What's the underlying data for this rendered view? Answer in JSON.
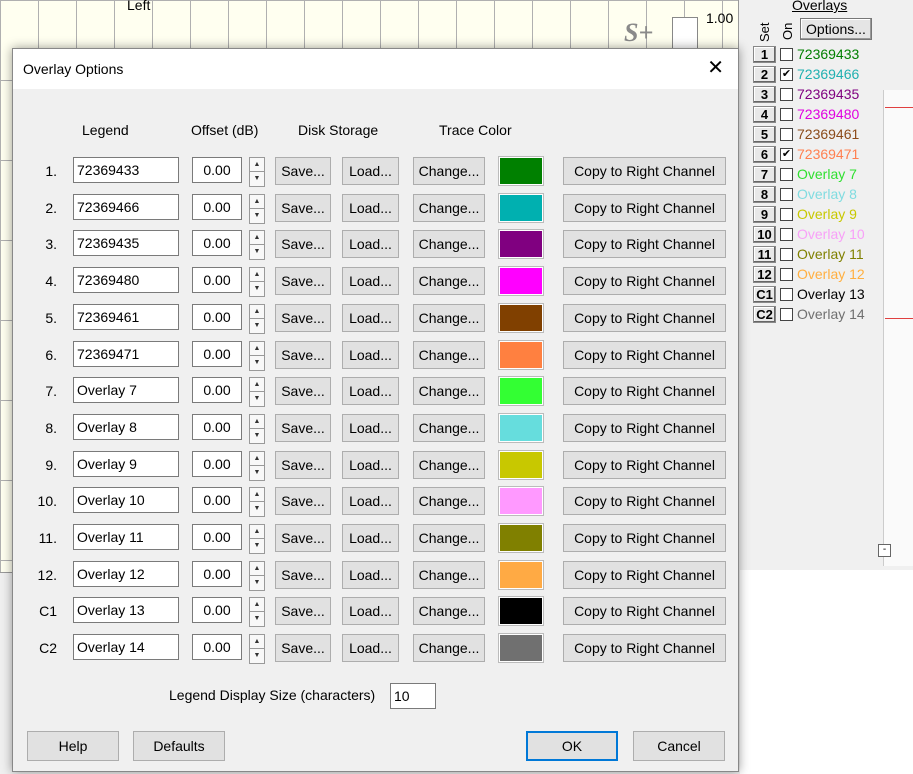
{
  "background": {
    "top_label": "Left",
    "logo_text": "S+",
    "scale_value": "1.00",
    "overlays_panel": {
      "title": "Overlays",
      "set_header": "Set",
      "on_header": "On",
      "options_label": "Options...",
      "minimize_glyph": "-",
      "items": [
        {
          "set": "1",
          "checked": false,
          "name": "72369433",
          "color": "#008000"
        },
        {
          "set": "2",
          "checked": true,
          "name": "72369466",
          "color": "#20b0b0"
        },
        {
          "set": "3",
          "checked": false,
          "name": "72369435",
          "color": "#800080"
        },
        {
          "set": "4",
          "checked": false,
          "name": "72369480",
          "color": "#e000e0"
        },
        {
          "set": "5",
          "checked": false,
          "name": "72369461",
          "color": "#8b4a1a"
        },
        {
          "set": "6",
          "checked": true,
          "name": "72369471",
          "color": "#ff7f50"
        },
        {
          "set": "7",
          "checked": false,
          "name": "Overlay 7",
          "color": "#30e030"
        },
        {
          "set": "8",
          "checked": false,
          "name": "Overlay 8",
          "color": "#80dce0"
        },
        {
          "set": "9",
          "checked": false,
          "name": "Overlay 9",
          "color": "#c8c800"
        },
        {
          "set": "10",
          "checked": false,
          "name": "Overlay 10",
          "color": "#f8a0f8"
        },
        {
          "set": "11",
          "checked": false,
          "name": "Overlay 11",
          "color": "#808000"
        },
        {
          "set": "12",
          "checked": false,
          "name": "Overlay 12",
          "color": "#ffb040"
        },
        {
          "set": "C1",
          "checked": false,
          "name": "Overlay 13",
          "color": "#000000"
        },
        {
          "set": "C2",
          "checked": false,
          "name": "Overlay 14",
          "color": "#707070"
        }
      ]
    }
  },
  "dialog": {
    "title": "Overlay Options",
    "close_glyph": "✕",
    "headers": {
      "legend": "Legend",
      "offset": "Offset (dB)",
      "disk_storage": "Disk Storage",
      "trace_color": "Trace Color"
    },
    "buttons": {
      "save": "Save...",
      "load": "Load...",
      "change": "Change...",
      "copy": "Copy to Right Channel"
    },
    "rows": [
      {
        "label": "1.",
        "legend": "72369433",
        "offset": "0.00",
        "color": "#008000"
      },
      {
        "label": "2.",
        "legend": "72369466",
        "offset": "0.00",
        "color": "#00b0b0"
      },
      {
        "label": "3.",
        "legend": "72369435",
        "offset": "0.00",
        "color": "#800080"
      },
      {
        "label": "4.",
        "legend": "72369480",
        "offset": "0.00",
        "color": "#ff00ff"
      },
      {
        "label": "5.",
        "legend": "72369461",
        "offset": "0.00",
        "color": "#804000"
      },
      {
        "label": "6.",
        "legend": "72369471",
        "offset": "0.00",
        "color": "#ff8040"
      },
      {
        "label": "7.",
        "legend": "Overlay 7",
        "offset": "0.00",
        "color": "#33ff33"
      },
      {
        "label": "8.",
        "legend": "Overlay 8",
        "offset": "0.00",
        "color": "#66dddd"
      },
      {
        "label": "9.",
        "legend": "Overlay 9",
        "offset": "0.00",
        "color": "#c8c800"
      },
      {
        "label": "10.",
        "legend": "Overlay 10",
        "offset": "0.00",
        "color": "#ff99ff"
      },
      {
        "label": "11.",
        "legend": "Overlay 11",
        "offset": "0.00",
        "color": "#808000"
      },
      {
        "label": "12.",
        "legend": "Overlay 12",
        "offset": "0.00",
        "color": "#ffaa44"
      },
      {
        "label": "C1",
        "legend": "Overlay 13",
        "offset": "0.00",
        "color": "#000000"
      },
      {
        "label": "C2",
        "legend": "Overlay 14",
        "offset": "0.00",
        "color": "#707070"
      }
    ],
    "legend_display_size_label": "Legend Display Size (characters)",
    "legend_display_size_value": "10",
    "footer": {
      "help": "Help",
      "defaults": "Defaults",
      "ok": "OK",
      "cancel": "Cancel"
    }
  }
}
